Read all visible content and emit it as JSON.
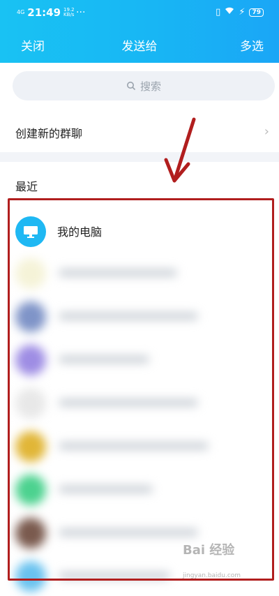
{
  "status": {
    "signal": "4G",
    "time": "21:49",
    "speed": "19.2 KB/s",
    "dots": "···",
    "battery": "79"
  },
  "header": {
    "close_label": "关闭",
    "title": "发送给",
    "multi_label": "多选"
  },
  "search": {
    "placeholder": "搜索"
  },
  "create_group": {
    "label": "创建新的群聊"
  },
  "recent": {
    "title": "最近",
    "items": [
      {
        "name": "我的电脑",
        "avatar_color": "#1fb8f3",
        "icon": "monitor-icon"
      },
      {
        "name": "",
        "avatar_color": "#f5f3d8"
      },
      {
        "name": "",
        "avatar_color": "#7f94c8"
      },
      {
        "name": "",
        "avatar_color": "#9e8de4"
      },
      {
        "name": "",
        "avatar_color": "#e8e8e8"
      },
      {
        "name": "",
        "avatar_color": "#e1b637"
      },
      {
        "name": "",
        "avatar_color": "#4cd28f"
      },
      {
        "name": "",
        "avatar_color": "#7a5a4e"
      },
      {
        "name": "",
        "avatar_color": "#69c2ef"
      }
    ]
  },
  "watermark": {
    "text": "Bai 经验",
    "sub": "jingyan.baidu.com"
  }
}
